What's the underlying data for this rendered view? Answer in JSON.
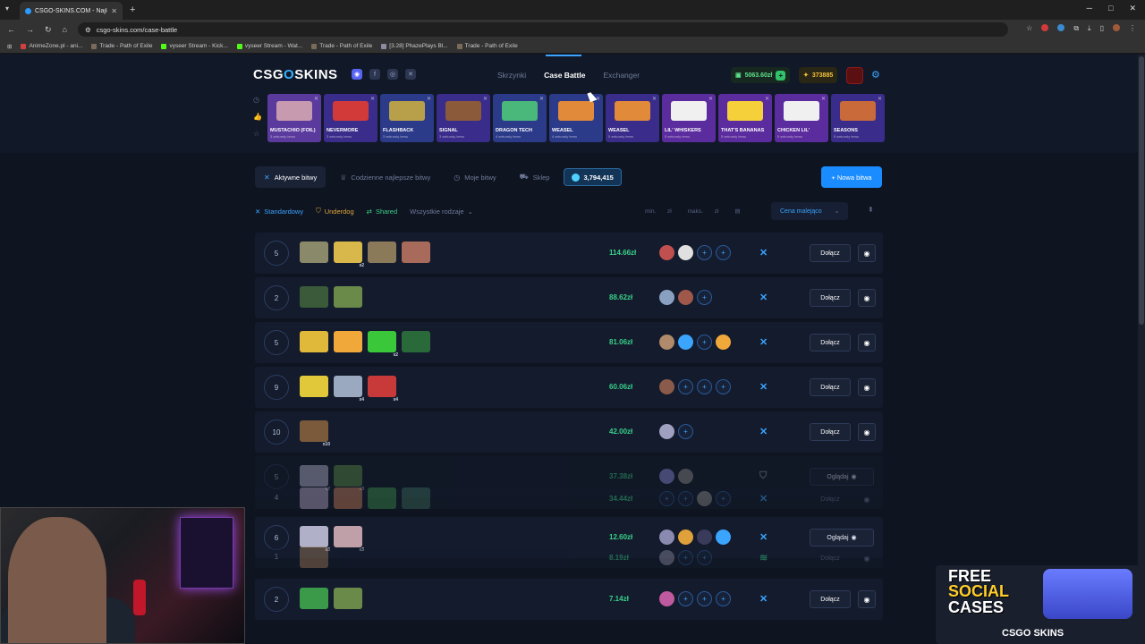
{
  "browser": {
    "tab_title": "CSGO-SKINS.COM - Najlepsze",
    "url": "csgo-skins.com/case-battle",
    "bookmarks": [
      "AnimeZone.pl - ani...",
      "Trade - Path of Exile",
      "vyseer Stream - Kick...",
      "vyseer Stream - Wat...",
      "Trade - Path of Exile",
      "[3.28] PhazePlays Bl...",
      "Trade - Path of Exile"
    ]
  },
  "header": {
    "logo_text": "CSG",
    "logo_o": "O",
    "logo_rest": "SKINS",
    "nav": [
      "Skrzynki",
      "Case Battle",
      "Exchanger"
    ],
    "balance": "5063.60zł",
    "coins": "373885"
  },
  "live_feed": [
    {
      "name": "MUSTACHIO (FOIL)",
      "sub": "3 sekundy temu",
      "bg": "#5b3a9e",
      "skin": "#c79ab0"
    },
    {
      "name": "NEVERMORE",
      "sub": "3 sekundy temu",
      "bg": "#3a2c8a",
      "skin": "#d23a3a"
    },
    {
      "name": "FLASHBACK",
      "sub": "3 sekundy temu",
      "bg": "#2c3a8a",
      "skin": "#b8a04a"
    },
    {
      "name": "SIGNAL",
      "sub": "3 sekundy temu",
      "bg": "#3a2c8a",
      "skin": "#8a5a3a"
    },
    {
      "name": "DRAGON TECH",
      "sub": "4 sekundy temu",
      "bg": "#2c3a8a",
      "skin": "#4ab87a"
    },
    {
      "name": "WEASEL",
      "sub": "4 sekundy temu",
      "bg": "#2c3a8a",
      "skin": "#e08a3a"
    },
    {
      "name": "WEASEL",
      "sub": "5 sekundy temu",
      "bg": "#3a2c8a",
      "skin": "#e08a3a"
    },
    {
      "name": "LIL' WHISKERS",
      "sub": "5 sekundy temu",
      "bg": "#5b2c9e",
      "skin": "#f0f0f0"
    },
    {
      "name": "THAT'S BANANAS",
      "sub": "5 sekundy temu",
      "bg": "#5b2c9e",
      "skin": "#f5d03a"
    },
    {
      "name": "CHICKEN LIL'",
      "sub": "5 sekundy temu",
      "bg": "#5b2c9e",
      "skin": "#f0f0f0"
    },
    {
      "name": "SEASONS",
      "sub": "5 sekundy temu",
      "bg": "#3a2c8a",
      "skin": "#c86a3a"
    }
  ],
  "tabs": {
    "active": "Aktywne bitwy",
    "daily": "Codzienne najlepsze bitwy",
    "mine": "Moje bitwy",
    "shop": "Sklep",
    "gems": "3,794,415",
    "new_battle": "+ Nowa bitwa"
  },
  "filters": {
    "standard": "Standardowy",
    "underdog": "Underdog",
    "shared": "Shared",
    "all_types": "Wszystkie rodzaje",
    "min": "min.",
    "max": "maks.",
    "currency": "zł",
    "sort": "Cena malejąco"
  },
  "labels": {
    "join": "Dołącz",
    "watch": "Oglądaj"
  },
  "battles": [
    {
      "round": "5",
      "price": "114.66zł",
      "mode": "standard",
      "action": "join",
      "dim": false,
      "cases": [
        {
          "c": "#8a8a6a"
        },
        {
          "c": "#d8b84a",
          "m": "x2"
        },
        {
          "c": "#8a7a5a"
        },
        {
          "c": "#a86a5a"
        }
      ],
      "players": [
        "#c05050",
        "#e0e0e0",
        "",
        ""
      ]
    },
    {
      "round": "2",
      "price": "88.62zł",
      "mode": "standard",
      "action": "join",
      "dim": false,
      "cases": [
        {
          "c": "#3a5a3a"
        },
        {
          "c": "#6a8a4a"
        }
      ],
      "players": [
        "#8aa0c0",
        "#a0584a",
        ""
      ]
    },
    {
      "round": "5",
      "price": "81.06zł",
      "mode": "standard",
      "action": "join",
      "dim": false,
      "cases": [
        {
          "c": "#e0b83a"
        },
        {
          "c": "#f0a83a"
        },
        {
          "c": "#3ac83a",
          "m": "x2"
        },
        {
          "c": "#2a6a3a"
        }
      ],
      "players": [
        "#b08a6a",
        "#3aa4ff",
        "",
        "#f0a83a"
      ]
    },
    {
      "round": "9",
      "price": "60.06zł",
      "mode": "standard",
      "action": "join",
      "dim": false,
      "cases": [
        {
          "c": "#e0c83a"
        },
        {
          "c": "#9aa8c0",
          "m": "x4"
        },
        {
          "c": "#c83a3a",
          "m": "x4"
        }
      ],
      "players": [
        "#8a5a4a",
        "",
        "",
        ""
      ]
    },
    {
      "round": "10",
      "price": "42.00zł",
      "mode": "standard",
      "action": "join",
      "dim": false,
      "cases": [
        {
          "c": "#7a5a3a",
          "m": "x10"
        }
      ],
      "players": [
        "#a0a0c0",
        ""
      ]
    },
    {
      "round": "5",
      "price": "37.38zł",
      "mode": "underdog",
      "action": "watch",
      "dim": true,
      "cases": [
        {
          "c": "#b0b0c8",
          "m": "x2"
        },
        {
          "c": "#5a8a4a",
          "m": "x3"
        }
      ],
      "players": [
        "#8a8ad8",
        "#8a8a8a"
      ]
    },
    {
      "round": "4",
      "price": "34.44zł",
      "mode": "standard",
      "action": "eye_only",
      "dim": true,
      "cases": [
        {
          "c": "#b0a0c0"
        },
        {
          "c": "#c07a5a"
        },
        {
          "c": "#3a8a4a"
        },
        {
          "c": "#3a6a5a"
        }
      ],
      "players": [
        "",
        "",
        "#8a8a8a",
        ""
      ]
    },
    {
      "round": "6",
      "price": "12.60zł",
      "mode": "standard",
      "action": "watch",
      "dim": false,
      "cases": [
        {
          "c": "#b0b0c8",
          "m": "x3"
        },
        {
          "c": "#c0a0a8",
          "m": "x3"
        }
      ],
      "players": [
        "#8a8ab0",
        "#e0a03a",
        "#3a3a5a",
        "#3aa4ff"
      ]
    },
    {
      "round": "1",
      "price": "8.19zł",
      "mode": "shared",
      "action": "eye_only",
      "dim": true,
      "cases": [
        {
          "c": "#a07a5a"
        }
      ],
      "players": [
        "#8a8aa0",
        "",
        ""
      ]
    },
    {
      "round": "2",
      "price": "7.14zł",
      "mode": "standard",
      "action": "join",
      "dim": false,
      "cases": [
        {
          "c": "#3a9a4a"
        },
        {
          "c": "#6a8a4a"
        }
      ],
      "players": [
        "#c05aa0",
        "",
        "",
        ""
      ]
    }
  ],
  "promo": {
    "line1": "FREE",
    "line2": "SOCIAL",
    "line3": "CASES",
    "brand": "CSGO SKINS"
  }
}
